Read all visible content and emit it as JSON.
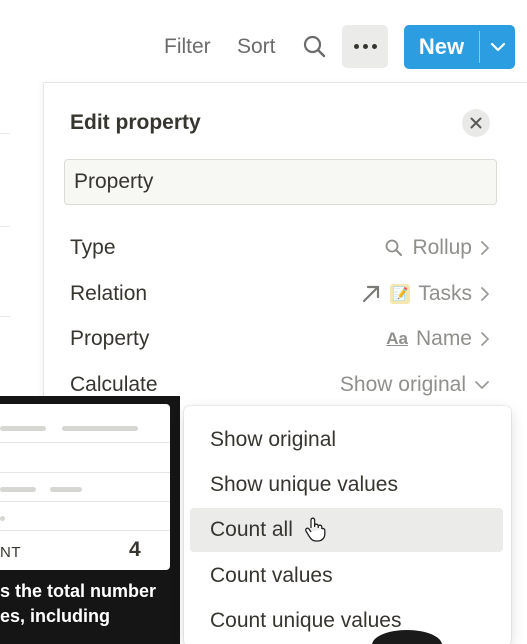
{
  "toolbar": {
    "filter_label": "Filter",
    "sort_label": "Sort",
    "search_icon": "search-icon",
    "more_icon": "more-icon",
    "new_label": "New",
    "new_color": "#2c9de0"
  },
  "panel": {
    "title": "Edit property",
    "property_name": "Property",
    "rows": [
      {
        "label": "Type",
        "value": "Rollup",
        "icon": "search-icon"
      },
      {
        "label": "Relation",
        "value": "Tasks",
        "icon": "arrow-up-right-icon",
        "emoji": "📝"
      },
      {
        "label": "Property",
        "value": "Name",
        "icon": "text-aa-icon",
        "icon_text": "Aa"
      },
      {
        "label": "Calculate",
        "value": "Show original"
      }
    ]
  },
  "dropdown": {
    "items": [
      "Show original",
      "Show unique values",
      "Count all",
      "Count values",
      "Count unique values"
    ],
    "hovered": "Count all"
  },
  "tooltip": {
    "count_label": "NT",
    "count_value": "4",
    "description": "s the total number es, including"
  }
}
